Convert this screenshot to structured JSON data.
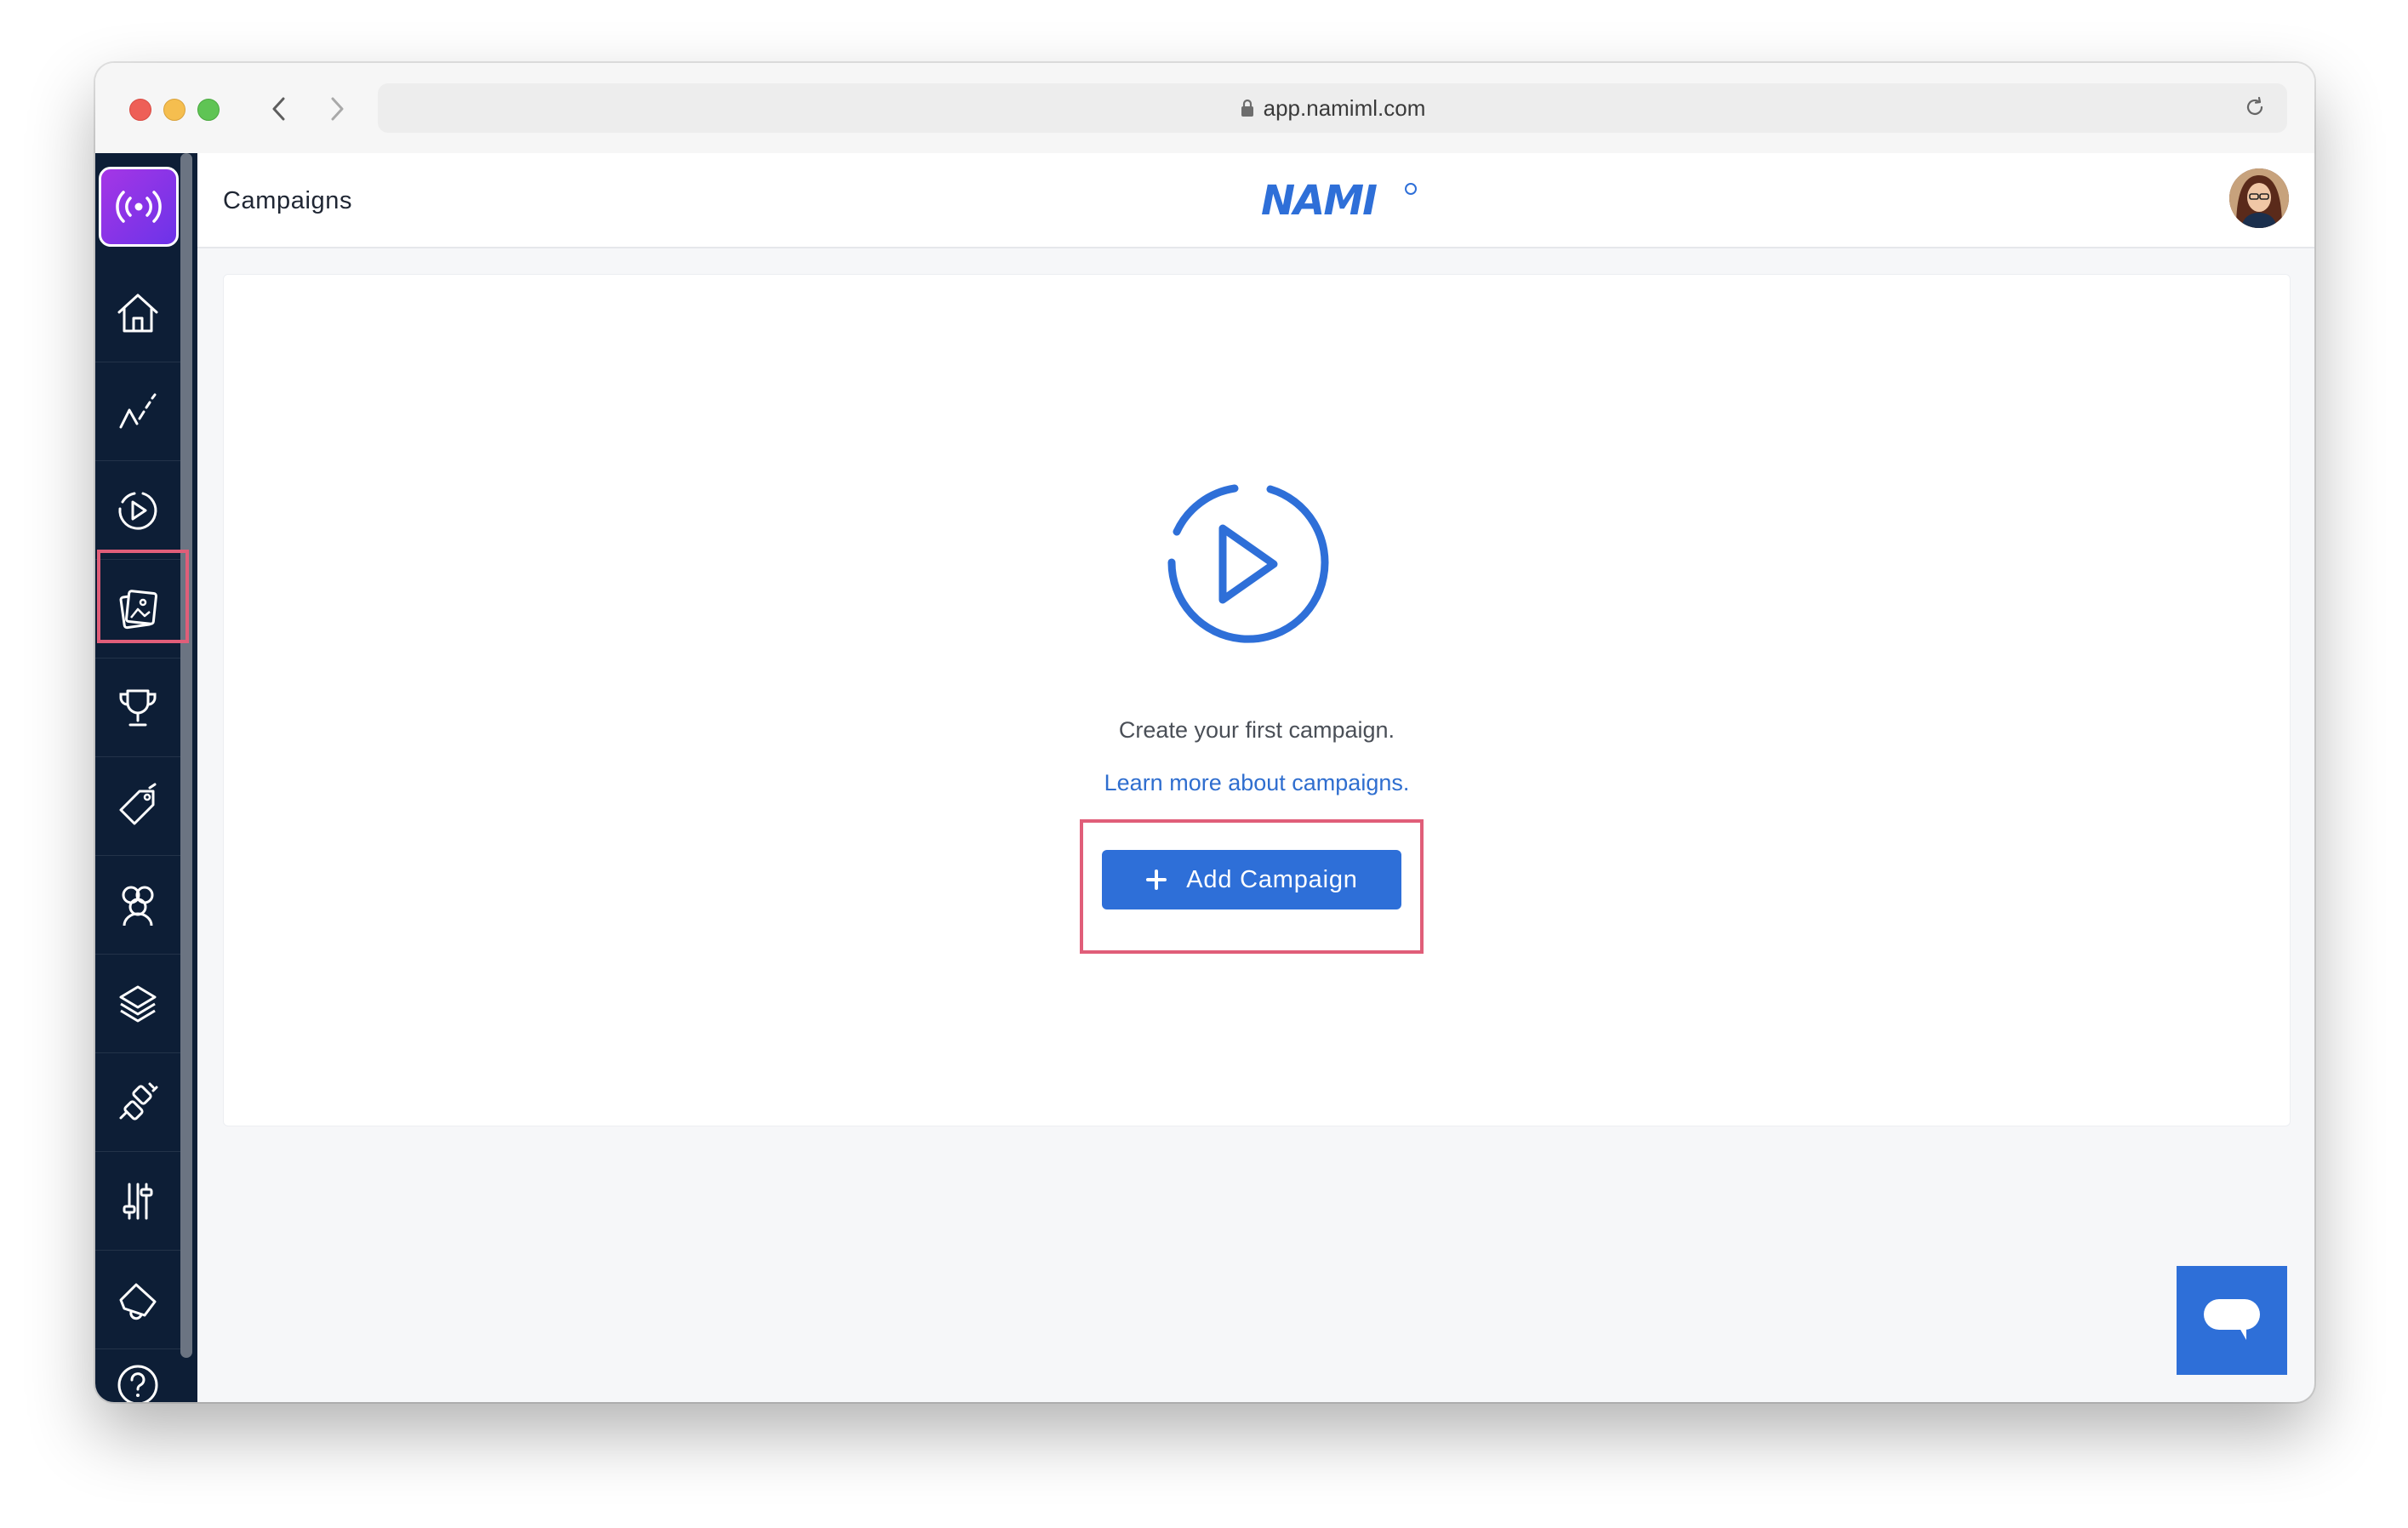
{
  "browser": {
    "url": "app.namiml.com"
  },
  "header": {
    "page_title": "Campaigns",
    "brand": "NAMI"
  },
  "sidebar": {
    "items": [
      {
        "name": "home",
        "icon": "home-icon"
      },
      {
        "name": "analytics",
        "icon": "analytics-line-icon"
      },
      {
        "name": "campaigns",
        "icon": "campaign-play-icon",
        "selected": true
      },
      {
        "name": "paywalls",
        "icon": "gallery-icon"
      },
      {
        "name": "entitlements",
        "icon": "trophy-icon"
      },
      {
        "name": "products",
        "icon": "tag-icon"
      },
      {
        "name": "customers",
        "icon": "people-icon"
      },
      {
        "name": "platforms",
        "icon": "layers-icon"
      },
      {
        "name": "integrations",
        "icon": "plug-icon"
      },
      {
        "name": "settings",
        "icon": "sliders-icon"
      },
      {
        "name": "announcements",
        "icon": "megaphone-icon"
      },
      {
        "name": "help",
        "icon": "help-icon"
      }
    ]
  },
  "empty_state": {
    "message": "Create your first campaign.",
    "link": "Learn more about campaigns.",
    "button": "Add Campaign"
  },
  "colors": {
    "accent": "#2e6fd8",
    "sidebar_bg": "#0d1e36",
    "highlight": "#e05e79"
  }
}
